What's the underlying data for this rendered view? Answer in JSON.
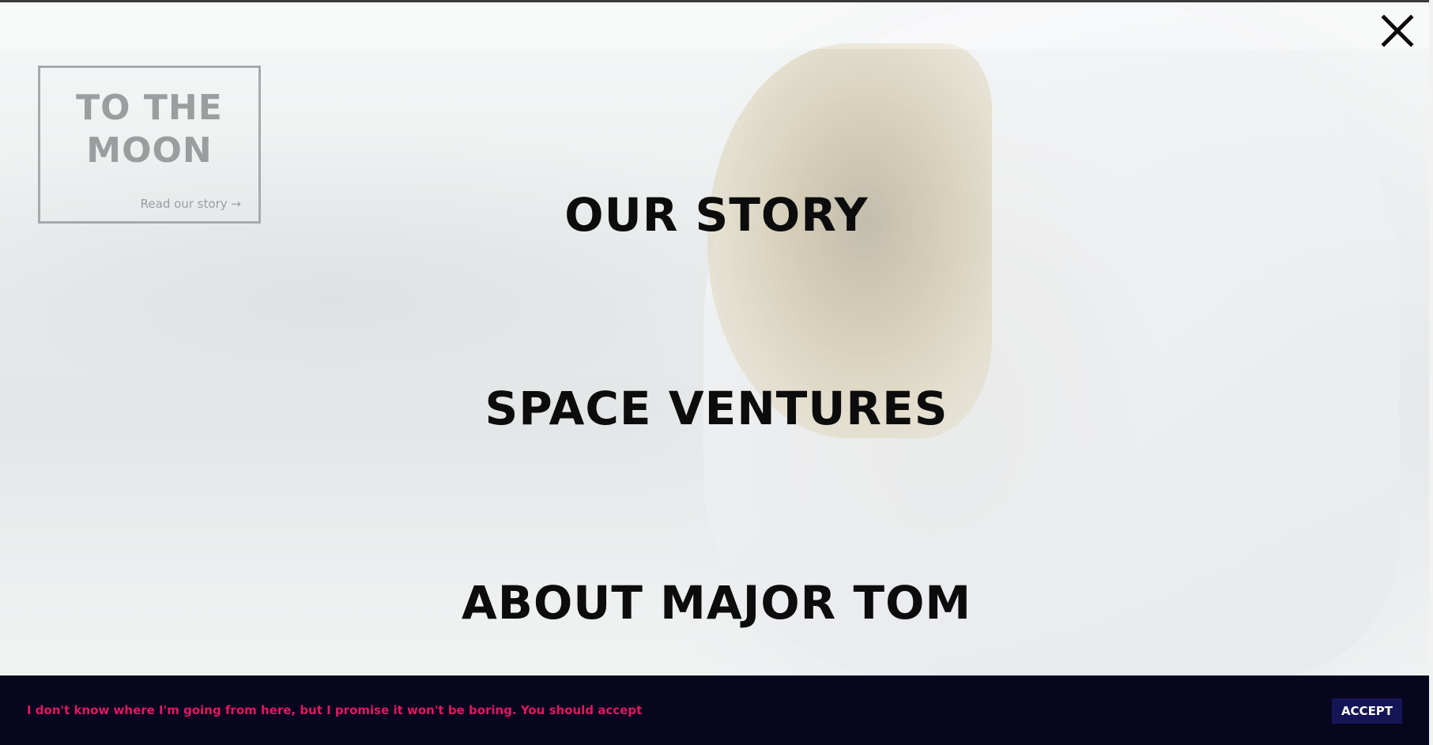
{
  "logo": {
    "title_line1": "TO THE",
    "title_line2": "MOON",
    "link_label": "Read our story →"
  },
  "close": {
    "icon": "close-icon"
  },
  "menu": {
    "items": [
      {
        "label": "OUR STORY"
      },
      {
        "label": "SPACE VENTURES"
      },
      {
        "label": "ABOUT MAJOR TOM"
      }
    ]
  },
  "cookie_banner": {
    "message": "I don't know where I'm going from here, but I promise it won't be boring. You should accept",
    "accept_label": "ACCEPT",
    "background_color": "#06061f",
    "text_color": "#e0195f",
    "button_color": "#151556"
  },
  "colors": {
    "menu_text": "#0c0c0c",
    "logo_gray": "#9b9d9f"
  }
}
